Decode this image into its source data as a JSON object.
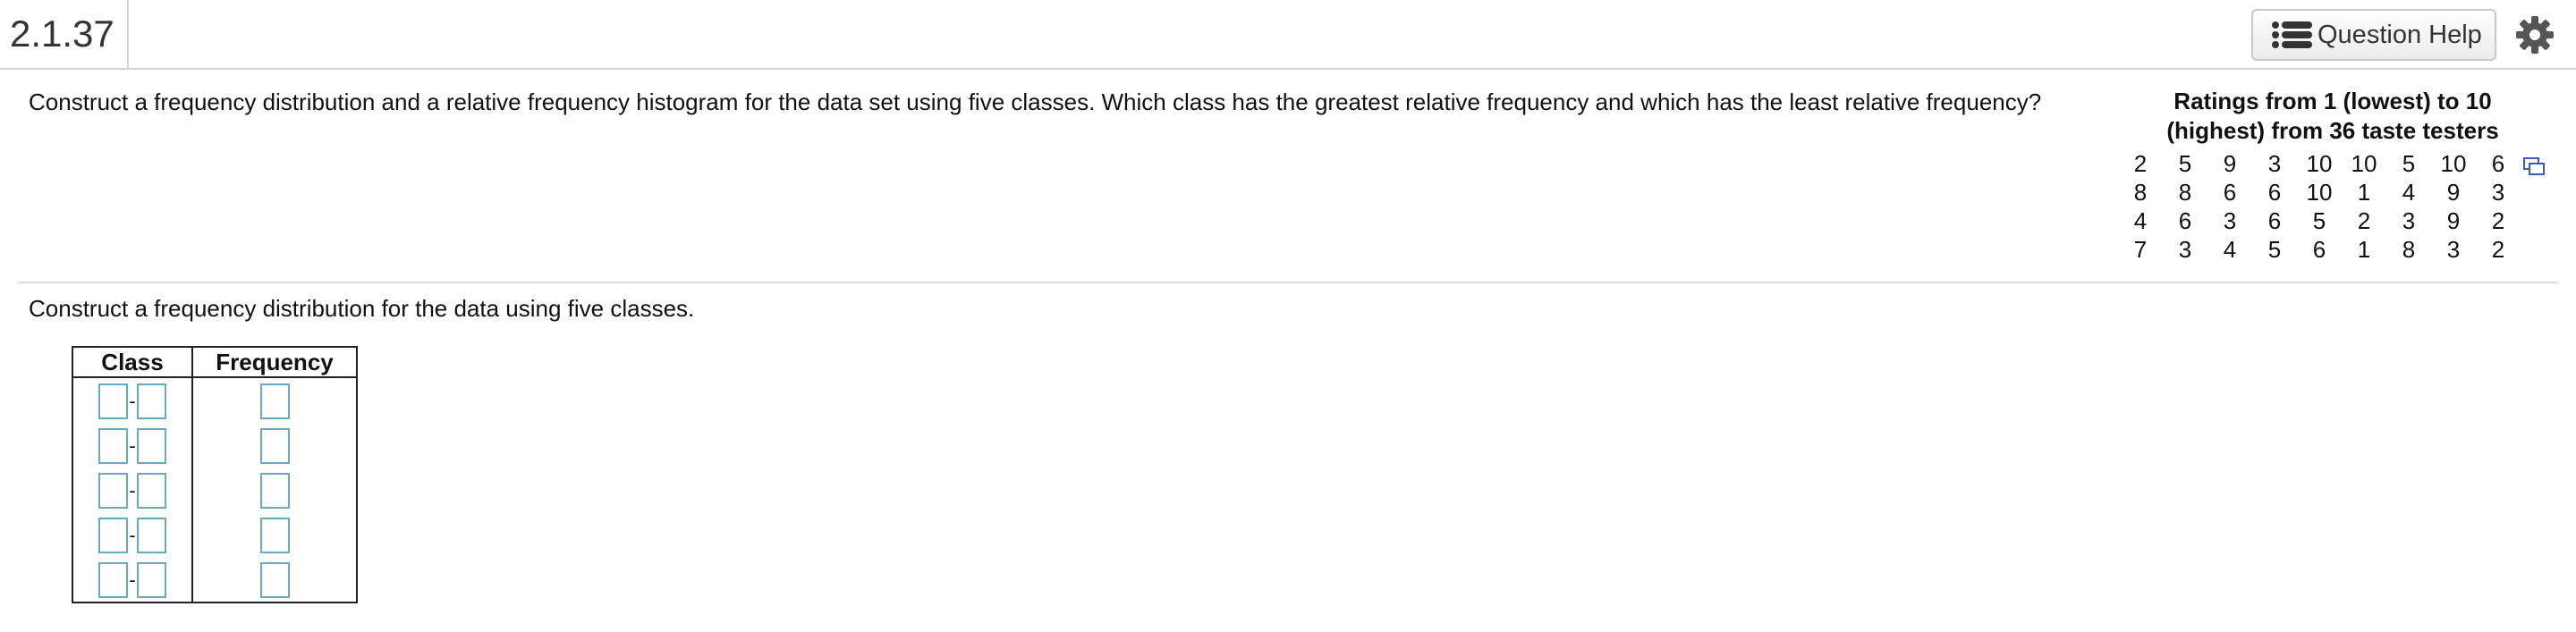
{
  "header": {
    "problem_number": "2.1.37",
    "help_label": "Question Help"
  },
  "question_text": "Construct a frequency distribution and a relative frequency histogram for the data set using five classes. Which class has the greatest relative frequency and which has the least relative frequency?",
  "dataset": {
    "title_line1": "Ratings from 1 (lowest) to 10",
    "title_line2": "(highest) from 36 taste testers",
    "rows": [
      [
        "2",
        "5",
        "9",
        "3",
        "10",
        "10",
        "5",
        "10",
        "6"
      ],
      [
        "8",
        "8",
        "6",
        "6",
        "10",
        "1",
        "4",
        "9",
        "3"
      ],
      [
        "4",
        "6",
        "3",
        "6",
        "5",
        "2",
        "3",
        "9",
        "2"
      ],
      [
        "7",
        "3",
        "4",
        "5",
        "6",
        "1",
        "8",
        "3",
        "2"
      ]
    ]
  },
  "instruction": "Construct a frequency distribution for the data using five classes.",
  "table": {
    "col_class": "Class",
    "col_frequency": "Frequency",
    "dash": "-",
    "rows": [
      {
        "lower": "",
        "upper": "",
        "frequency": ""
      },
      {
        "lower": "",
        "upper": "",
        "frequency": ""
      },
      {
        "lower": "",
        "upper": "",
        "frequency": ""
      },
      {
        "lower": "",
        "upper": "",
        "frequency": ""
      },
      {
        "lower": "",
        "upper": "",
        "frequency": ""
      }
    ]
  },
  "colors": {
    "input_border": "#6ba8c6",
    "divider": "#dcdcdc",
    "copy_icon": "#3a5bbf"
  }
}
